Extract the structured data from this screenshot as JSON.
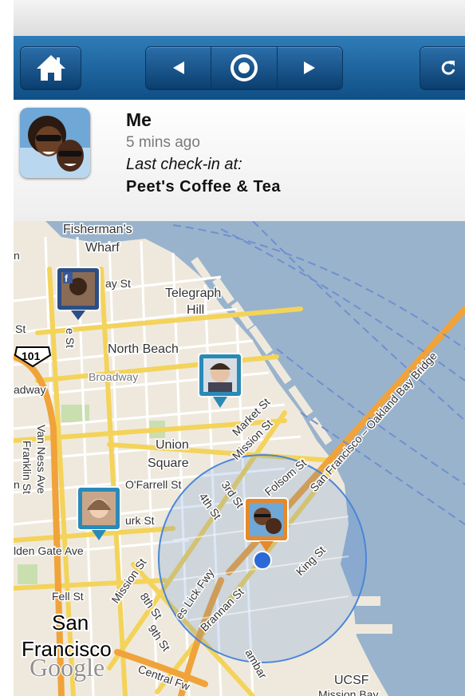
{
  "toolbar": {
    "home_icon": "home-icon",
    "prev_icon": "triangle-left-icon",
    "center_icon": "target-icon",
    "next_icon": "triangle-right-icon",
    "refresh_icon": "refresh-icon"
  },
  "profile": {
    "name": "Me",
    "time_ago": "5 mins ago",
    "checkin_label": "Last check-in at:",
    "place": "Peet's Coffee & Tea"
  },
  "map": {
    "labels": {
      "fishermans_wharf_1": "Fisherman's",
      "fishermans_wharf_2": "Wharf",
      "telegraph_hill_1": "Telegraph",
      "telegraph_hill_2": "Hill",
      "north_beach": "North Beach",
      "broadway": "Broadway",
      "broadway_left": "adway",
      "union_square_1": "Union",
      "union_square_2": "Square",
      "san_francisco_1": "San",
      "san_francisco_2": "Francisco",
      "highway_101": "101",
      "van_ness": "Van Ness Ave",
      "franklin": "Franklin St",
      "ofarrell": "O'Farrell St",
      "turk": "urk St",
      "golden_gate": "lden Gate Ave",
      "fell": "Fell St",
      "mission_st_1": "Mission St",
      "mission_st_2": "Mission St",
      "market_st": "Market St",
      "third_st": "3rd St",
      "fourth_st": "4th St",
      "folsom": "Folsom St",
      "eighth": "8th St",
      "ninth": "9th St",
      "brannan": "Brannan St",
      "king": "King St",
      "lick_fwy": "es Lick Fwy",
      "bay_bridge": "San Francisco – Oakland Bay Bridge",
      "bay_st": "ay St",
      "st_left": "St",
      "n_left": "n",
      "n_left2": "n",
      "ne_st": "e St",
      "central_fwy": "Central Fw",
      "third_emb": "ambar",
      "ucsf_1": "UCSF",
      "ucsf_2": "Mission Bay",
      "google": "Google"
    },
    "pins": [
      {
        "name": "facebook-friend",
        "color": "#2c4e86"
      },
      {
        "name": "friend-male",
        "color": "#2a8ab7"
      },
      {
        "name": "friend-female",
        "color": "#2a8ab7"
      },
      {
        "name": "me",
        "color": "#e5892b"
      }
    ],
    "accuracy_circle_color": "#4a86d8",
    "water_color": "#99b3cc",
    "land_color": "#efe9dd"
  }
}
